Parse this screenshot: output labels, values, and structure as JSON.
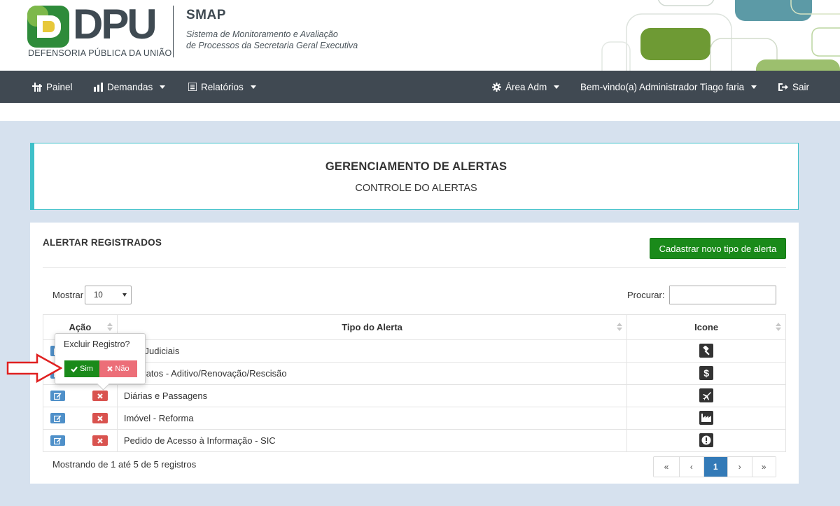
{
  "header": {
    "logo_text": "DPU",
    "logo_subtitle": "DEFENSORIA PÚBLICA DA UNIÃO",
    "app_name": "SMAP",
    "app_description_line1": "Sistema de Monitoramento e Avaliação",
    "app_description_line2": "de Processos da Secretaria Geral Executiva"
  },
  "nav": {
    "painel": "Painel",
    "demandas": "Demandas",
    "relatorios": "Relatórios",
    "area_adm": "Área Adm",
    "welcome": "Bem-vindo(a) Administrador Tiago faria",
    "sair": "Sair"
  },
  "title_panel": {
    "title": "GERENCIAMENTO DE ALERTAS",
    "subtitle": "CONTROLE DO ALERTAS"
  },
  "section": {
    "title": "ALERTAR REGISTRADOS",
    "new_button": "Cadastrar novo tipo de alerta"
  },
  "controls": {
    "show_label": "Mostrar",
    "page_size": "10",
    "search_label": "Procurar:",
    "search_value": ""
  },
  "table": {
    "columns": [
      "Ação",
      "Tipo do Alerta",
      "Icone"
    ],
    "rows": [
      {
        "tipo": "Atos Judiciais",
        "icon": "gavel-icon"
      },
      {
        "tipo": "Contratos - Aditivo/Renovação/Rescisão",
        "icon": "dollar-icon"
      },
      {
        "tipo": "Diárias e Passagens",
        "icon": "plane-icon"
      },
      {
        "tipo": "Imóvel - Reforma",
        "icon": "industry-icon"
      },
      {
        "tipo": "Pedido de Acesso à Informação - SIC",
        "icon": "exclamation-circle-icon"
      }
    ]
  },
  "footer": {
    "info": "Mostrando de 1 até 5 de 5 registros",
    "pagination": [
      "«",
      "‹",
      "1",
      "›",
      "»"
    ],
    "current_page": "1"
  },
  "popover": {
    "title": "Excluir Registro?",
    "yes": "Sim",
    "no": "Não"
  },
  "colors": {
    "navbar": "#404952",
    "accent_cyan": "#3fc0c9",
    "success": "#1a8a1a",
    "danger": "#d9534f",
    "primary": "#337ab7"
  }
}
